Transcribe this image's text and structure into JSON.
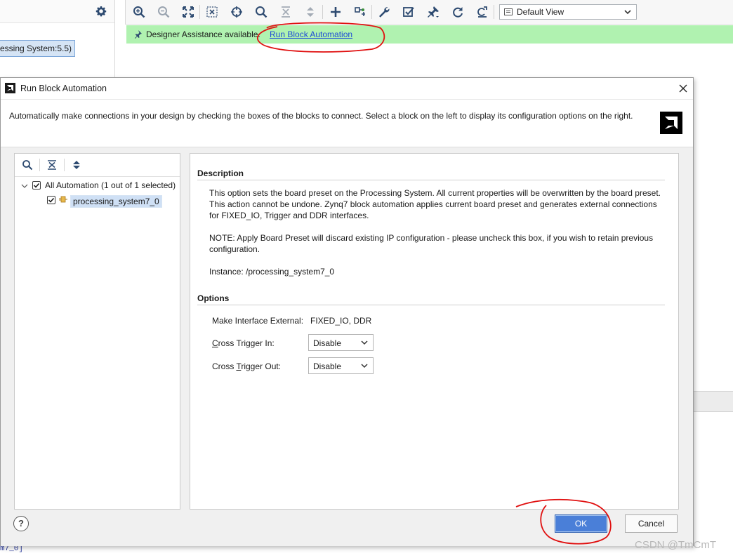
{
  "background": {
    "left_panel_item": "essing System:5.5)",
    "toolbar": {
      "view_select": "Default View",
      "icons": [
        "zoom-in-icon",
        "zoom-out-icon",
        "fit-icon",
        "fit-selection-icon",
        "target-icon",
        "search-icon",
        "collapse-all-icon",
        "expand-all-icon",
        "add-icon",
        "connect-icon",
        "wrench-icon",
        "validate-icon",
        "pin-icon",
        "refresh-icon",
        "regenerate-icon"
      ]
    },
    "assist_bar": {
      "text": "Designer Assistance available.",
      "link": "Run Block Automation",
      "color": "#b0f2b0"
    },
    "bottom_text": "m7_0]",
    "watermark": "CSDN @TmCmT"
  },
  "dialog": {
    "title": "Run Block Automation",
    "description": "Automatically make connections in your design by checking the boxes of the blocks to connect. Select a block on the left to display its configuration options on the right.",
    "tree": {
      "root": {
        "label": "All Automation (1 out of 1 selected)",
        "checked": true
      },
      "child": {
        "label": "processing_system7_0",
        "checked": true
      }
    },
    "details": {
      "description_title": "Description",
      "para1": "This option sets the board preset on the Processing System. All current properties will be overwritten by the board preset. This action cannot be undone. Zynq7 block automation applies current board preset and generates external connections for FIXED_IO, Trigger and DDR interfaces.",
      "para2": "NOTE: Apply Board Preset will discard existing IP configuration - please uncheck this box, if you wish to retain previous configuration.",
      "instance": "Instance: /processing_system7_0",
      "options_title": "Options",
      "make_interface_label": "Make Interface External:",
      "make_interface_value": "FIXED_IO, DDR",
      "cross_trigger_in": {
        "label_mnemonic": "C",
        "label_rest": "ross Trigger In:",
        "value": "Disable"
      },
      "cross_trigger_out": {
        "label_prefix": "Cross ",
        "label_mnemonic": "T",
        "label_rest": "rigger Out:",
        "value": "Disable"
      }
    },
    "buttons": {
      "help": "?",
      "ok": "OK",
      "cancel": "Cancel"
    },
    "ok_color": "#4a7fd8"
  },
  "annotations_color": "#e01010"
}
